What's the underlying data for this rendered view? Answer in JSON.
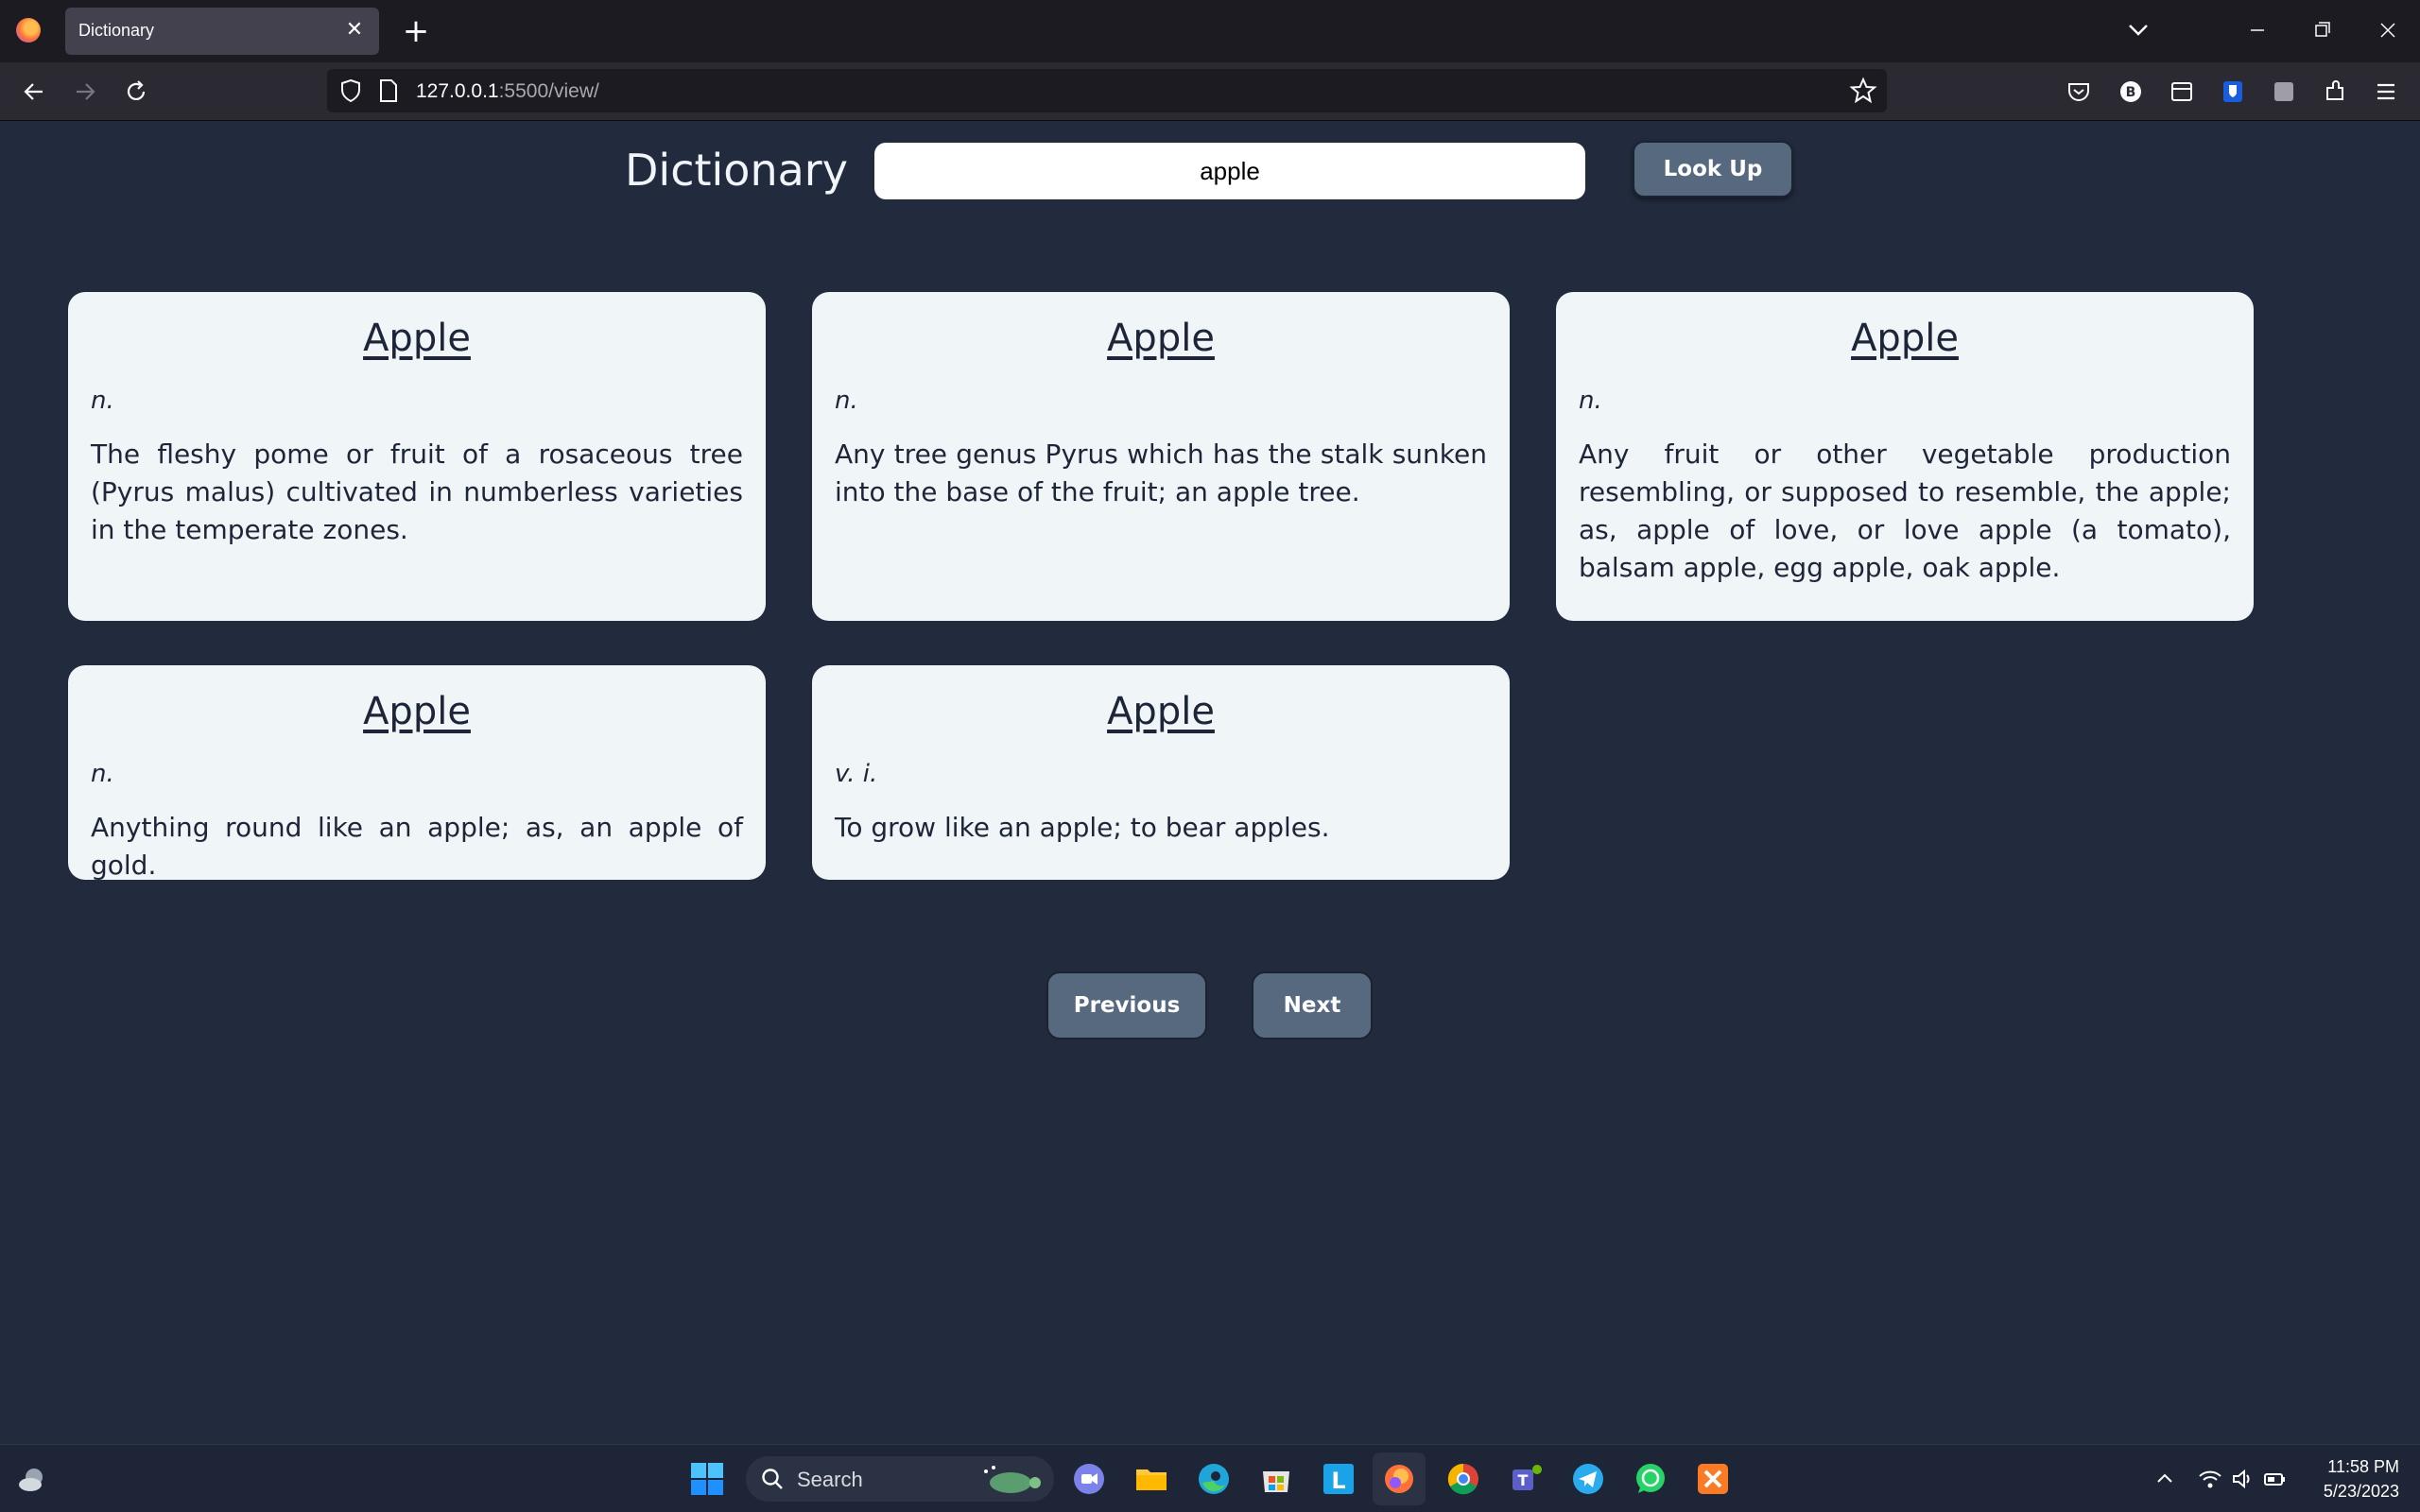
{
  "browser": {
    "tab_title": "Dictionary",
    "url_host": "127.0.0.1",
    "url_path": ":5500/view/"
  },
  "page": {
    "title": "Dictionary",
    "search": {
      "value": "apple"
    },
    "lookup_label": "Look Up",
    "entries": [
      {
        "word": "Apple",
        "pos": "n.",
        "definition": "The fleshy pome or fruit of a rosaceous tree (Pyrus malus) cultivated in numberless varieties in the temperate zones."
      },
      {
        "word": "Apple",
        "pos": "n.",
        "definition": "Any tree genus Pyrus which has the stalk sunken into the base of the fruit; an apple tree."
      },
      {
        "word": "Apple",
        "pos": "n.",
        "definition": "Any fruit or other vegetable production resembling, or supposed to resemble, the apple; as, apple of love, or love apple (a tomato), balsam apple, egg apple, oak apple."
      },
      {
        "word": "Apple",
        "pos": "n.",
        "definition": "Anything round like an apple; as, an apple of gold."
      },
      {
        "word": "Apple",
        "pos": "v. i.",
        "definition": "To grow like an apple; to bear apples."
      }
    ],
    "previous_label": "Previous",
    "next_label": "Next"
  },
  "taskbar": {
    "search_label": "Search",
    "time": "11:58 PM",
    "date": "5/23/2023"
  },
  "colors": {
    "page_bg": "#222b3e",
    "card_bg": "#f0f5f8",
    "button_bg": "#56697f",
    "text_dark": "#1d2638"
  }
}
